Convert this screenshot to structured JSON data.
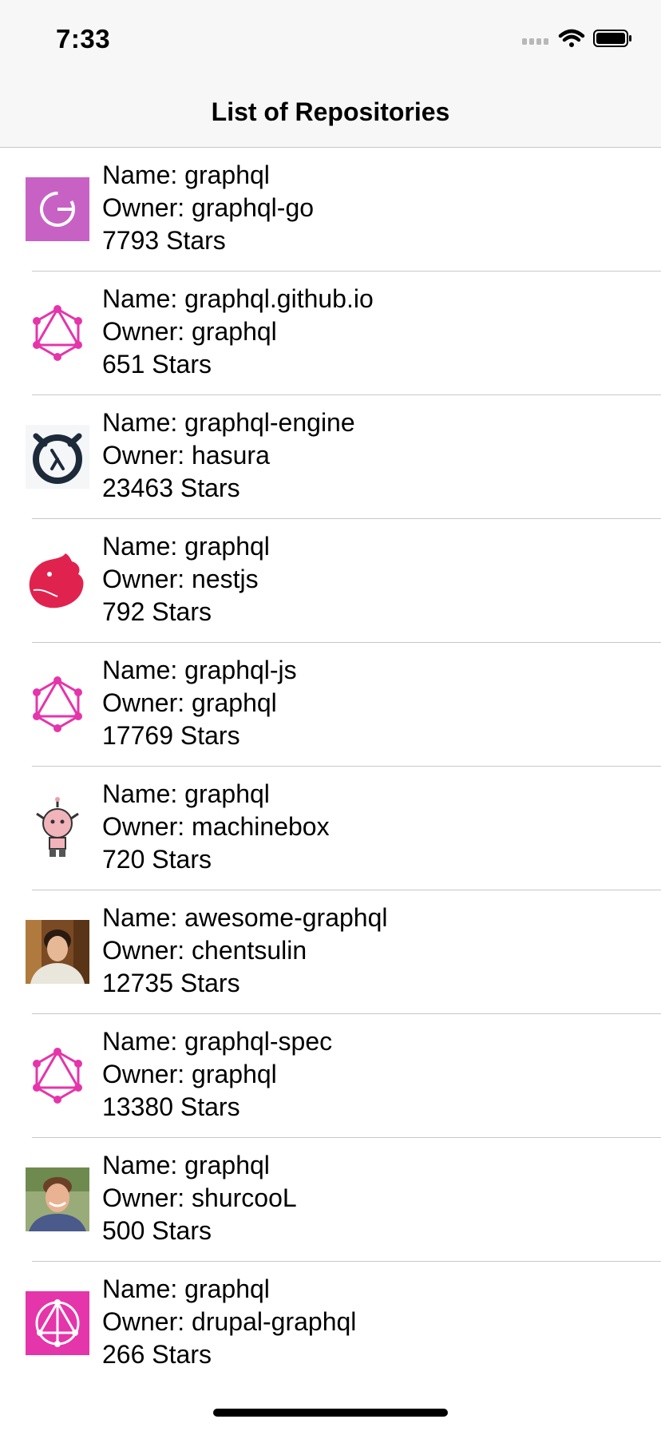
{
  "status_bar": {
    "time": "7:33"
  },
  "nav": {
    "title": "List of Repositories"
  },
  "repositories": [
    {
      "name_line": "Name: graphql",
      "owner_line": "Owner: graphql-go",
      "stars_line": "7793 Stars",
      "avatar_icon": "letter-g-avatar-icon"
    },
    {
      "name_line": "Name: graphql.github.io",
      "owner_line": "Owner: graphql",
      "stars_line": "651 Stars",
      "avatar_icon": "graphql-logo-icon"
    },
    {
      "name_line": "Name: graphql-engine",
      "owner_line": "Owner: hasura",
      "stars_line": "23463 Stars",
      "avatar_icon": "hasura-logo-icon"
    },
    {
      "name_line": "Name: graphql",
      "owner_line": "Owner: nestjs",
      "stars_line": "792 Stars",
      "avatar_icon": "nestjs-logo-icon"
    },
    {
      "name_line": "Name: graphql-js",
      "owner_line": "Owner: graphql",
      "stars_line": "17769 Stars",
      "avatar_icon": "graphql-logo-icon"
    },
    {
      "name_line": "Name: graphql",
      "owner_line": "Owner: machinebox",
      "stars_line": "720 Stars",
      "avatar_icon": "robot-avatar-icon"
    },
    {
      "name_line": "Name: awesome-graphql",
      "owner_line": "Owner: chentsulin",
      "stars_line": "12735 Stars",
      "avatar_icon": "person-photo-icon"
    },
    {
      "name_line": "Name: graphql-spec",
      "owner_line": "Owner: graphql",
      "stars_line": "13380 Stars",
      "avatar_icon": "graphql-logo-icon"
    },
    {
      "name_line": "Name: graphql",
      "owner_line": "Owner: shurcooL",
      "stars_line": "500 Stars",
      "avatar_icon": "person-photo-icon"
    },
    {
      "name_line": "Name: graphql",
      "owner_line": "Owner: drupal-graphql",
      "stars_line": "266 Stars",
      "avatar_icon": "drupal-graphql-logo-icon"
    }
  ],
  "colors": {
    "graphql_pink": "#e535ab",
    "nav_background": "#f7f7f7",
    "separator": "#c8c8cc"
  }
}
